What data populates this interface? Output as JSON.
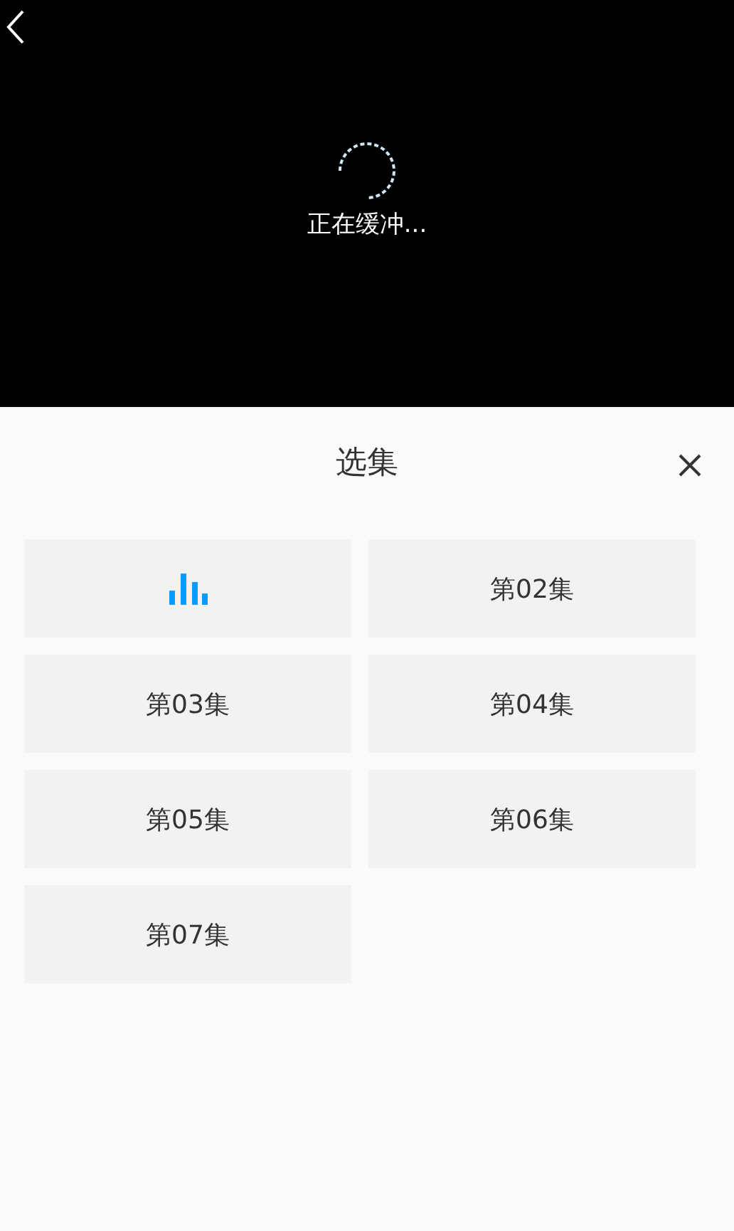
{
  "player": {
    "status": "正在缓冲..."
  },
  "panel": {
    "title": "选集"
  },
  "episodes": [
    {
      "selected": true
    },
    {
      "label": "第02集",
      "selected": false
    },
    {
      "label": "第03集",
      "selected": false
    },
    {
      "label": "第04集",
      "selected": false
    },
    {
      "label": "第05集",
      "selected": false
    },
    {
      "label": "第06集",
      "selected": false
    },
    {
      "label": "第07集",
      "selected": false
    }
  ]
}
